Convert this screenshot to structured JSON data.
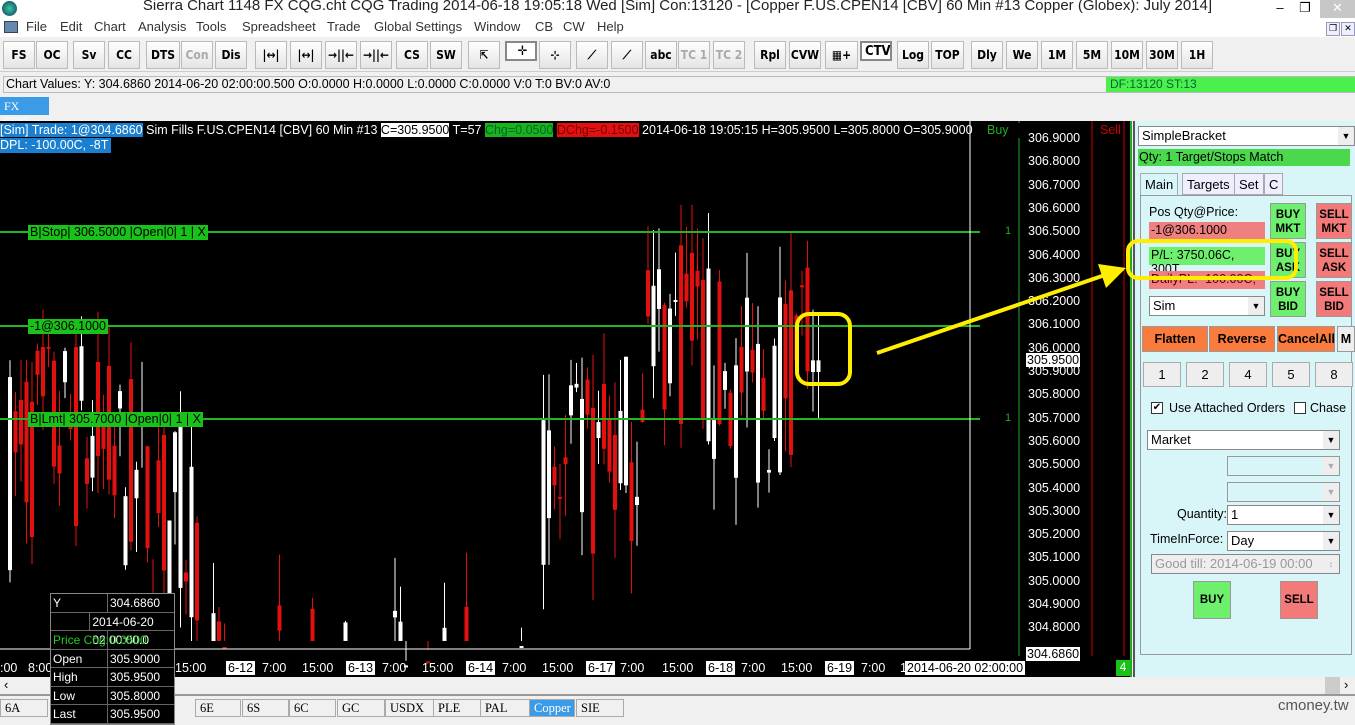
{
  "window": {
    "title": "Sierra Chart 1148 FX CQG.cht  CQG Trading 2014-06-18  19:05:18 Wed [Sim]  Con:13120 - [Copper  F.US.CPEN14 [CBV]  60 Min   #13  Copper (Globex): July 2014]",
    "minimize": "–",
    "maximize": "❐",
    "close": "✕"
  },
  "menu": [
    "File",
    "Edit",
    "Chart",
    "Analysis",
    "Tools",
    "Spreadsheet",
    "Trade",
    "Global Settings",
    "Window",
    "CB",
    "CW",
    "Help"
  ],
  "toolbar": [
    "FS",
    "OC",
    "Sv",
    "CC",
    "DTS",
    "Con",
    "Dis",
    "|↔|",
    "|↔|",
    "→||←",
    "→||←",
    "CS",
    "SW",
    "⇱",
    "✛",
    "⊹",
    "⟋",
    "⟋",
    "abc",
    "TC 1",
    "TC 2",
    "Rpl",
    "CVW",
    "▦+",
    "CTV",
    "Log",
    "TOP",
    "Dly",
    "We",
    "1M",
    "5M",
    "10M",
    "30M",
    "1H"
  ],
  "chart_values": "Chart Values: Y: 304.6860  2014-06-20  02:00:00.500  O:0.0000  H:0.0000  L:0.0000  C:0.0000  V:0  T:0  BV:0  AV:0",
  "df_status": "DF:13120  ST:13",
  "chart_tab": "FX CQG",
  "header": {
    "trade": "[Sim]  Trade: 1@304.6860",
    "info": " Sim Fills  F.US.CPEN14 [CBV]  60 Min   #13 ",
    "close": "C=305.9500",
    "ticks": " T=57 ",
    "chg": "Chg=0.0500",
    "dchg": "DChg=-0.1500",
    "rest": " 2014-06-18 19:05:15 H=305.9500 L=305.8000 O=305.9000",
    "dpl": "DPL: -100.00C, -8T",
    "buy": "Buy",
    "sell": "Sell"
  },
  "orders": {
    "stop": "B|Stop| 306.5000 |Open|0| 1 | X",
    "position": "-1@306.1000",
    "limit": "B|Lmt| 305.7000 |Open|0| 1 | X",
    "stop_qty": "1",
    "limit_qty": "1"
  },
  "price_axis": [
    "306.9000",
    "306.8000",
    "306.7000",
    "306.6000",
    "306.5000",
    "306.4000",
    "306.3000",
    "306.2000",
    "306.1000",
    "306.0000",
    "305.9000",
    "305.8000",
    "305.7000",
    "305.6000",
    "305.5000",
    "305.4000",
    "305.3000",
    "305.2000",
    "305.1000",
    "305.0000",
    "304.9000",
    "304.8000"
  ],
  "last_price": "305.9500",
  "cursor_price": "304.6860",
  "time_axis": [
    ":00",
    "8:00",
    "15:00",
    "6-12",
    "7:00",
    "15:00",
    "6-13",
    "7:00",
    "15:00",
    "6-14",
    "7:00",
    "15:00",
    "6-17",
    "7:00",
    "15:00",
    "6-18",
    "7:00",
    "15:00",
    "6-19",
    "7:00",
    "1"
  ],
  "cursor_time": "2014-06-20  02:00:00",
  "corner_count": "4",
  "tooltip": [
    [
      "Y",
      "304.6860"
    ],
    [
      "",
      "2014-06-20  02:00:00.0"
    ],
    [
      "Price Chg",
      "0.0500"
    ],
    [
      "Open",
      "305.9000"
    ],
    [
      "High",
      "305.9500"
    ],
    [
      "Low",
      "305.8000"
    ],
    [
      "Last",
      "305.9500"
    ]
  ],
  "panel": {
    "strategy": "SimpleBracket",
    "qty_match": "Qty: 1 Target/Stops Match",
    "tabs": [
      "Main",
      "Targets",
      "Set",
      "C"
    ],
    "pos_label": "Pos Qty@Price:",
    "pos": "-1@306.1000",
    "pl": "P/L: 3750.06C, 300T",
    "daily_pl": "DailyPL: -100.00C,",
    "account": "Sim",
    "buy_mkt": "BUY MKT",
    "sell_mkt": "SELL MKT",
    "buy_ask": "BUY ASK",
    "sell_ask": "SELL ASK",
    "buy_bid": "BUY BID",
    "sell_bid": "SELL BID",
    "flatten": "Flatten",
    "reverse": "Reverse",
    "cancel_all": "CancelAll",
    "m": "M",
    "qty_buttons": [
      "1",
      "2",
      "4",
      "5",
      "8"
    ],
    "use_attached": "Use Attached Orders",
    "chase": "Chase",
    "order_type": "Market",
    "quantity_label": "Quantity:",
    "quantity": "1",
    "tif_label": "TimeInForce:",
    "tif": "Day",
    "good_till": "Good till: 2014-06-19 00:00",
    "buy": "BUY",
    "sell": "SELL"
  },
  "sheet_tabs": [
    "6A",
    "",
    "6E",
    "6S",
    "6C",
    "GC",
    "USDX",
    "PLE",
    "PAL",
    "Copper",
    "SIE"
  ],
  "watermark": "cmoney.tw",
  "colors": {
    "bull": "#ffffff",
    "bear": "#e31010",
    "order_line": "#22b422",
    "highlight": "#ffee00"
  }
}
